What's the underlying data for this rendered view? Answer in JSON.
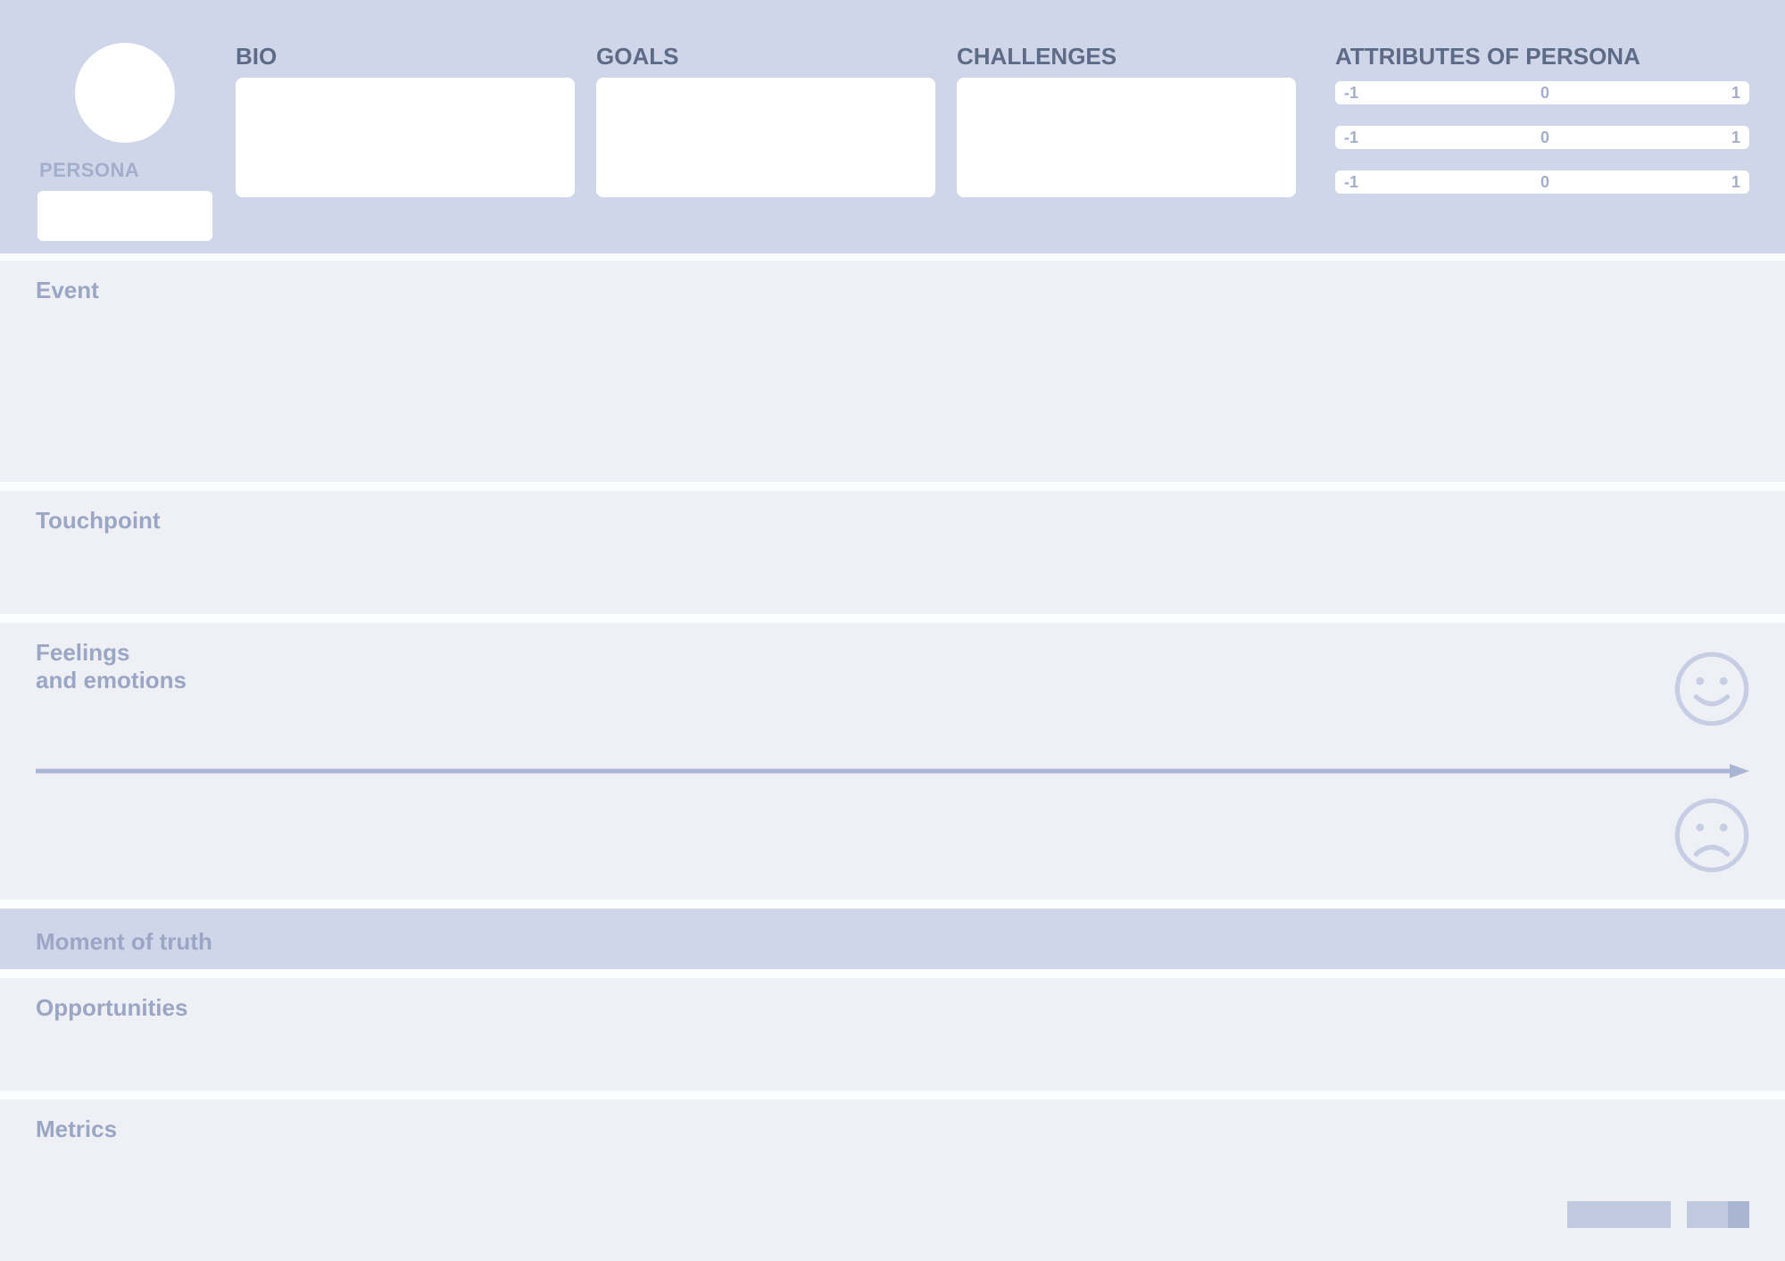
{
  "header": {
    "persona_label": "PERSONA",
    "persona_name": "",
    "bio_label": "BIO",
    "bio_text": "",
    "goals_label": "GOALS",
    "goals_text": "",
    "challenges_label": "CHALLENGES",
    "challenges_text": "",
    "attributes_label": "ATTRIBUTES OF PERSONA",
    "attribute_scales": [
      {
        "min": "-1",
        "mid": "0",
        "max": "1"
      },
      {
        "min": "-1",
        "mid": "0",
        "max": "1"
      },
      {
        "min": "-1",
        "mid": "0",
        "max": "1"
      }
    ]
  },
  "lanes": {
    "event": "Event",
    "touchpoint": "Touchpoint",
    "feelings_line1": "Feelings",
    "feelings_line2": "and emotions",
    "moment": "Moment of truth",
    "opportunities": "Opportunities",
    "metrics": "Metrics"
  }
}
